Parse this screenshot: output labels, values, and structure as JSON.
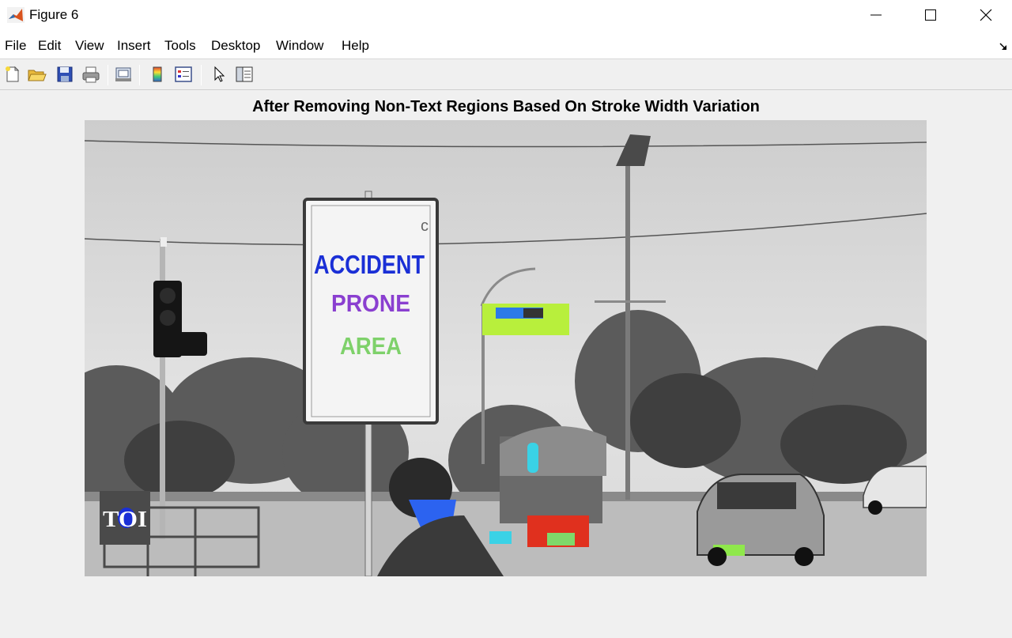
{
  "window": {
    "title": "Figure 6",
    "controls": [
      "minimize",
      "maximize",
      "close"
    ]
  },
  "menu": {
    "items": [
      "File",
      "Edit",
      "View",
      "Insert",
      "Tools",
      "Desktop",
      "Window",
      "Help"
    ]
  },
  "toolbar": {
    "buttons": [
      "new-figure-icon",
      "open-file-icon",
      "save-icon",
      "print-icon",
      "link-plot-icon",
      "insert-colorbar-icon",
      "insert-legend-icon",
      "edit-plot-arrow-icon",
      "property-inspector-icon"
    ]
  },
  "axes": {
    "title": "After Removing Non-Text Regions Based On Stroke Width Variation"
  },
  "image": {
    "sign_text": {
      "line1": "ACCIDENT",
      "line2": "PRONE",
      "line3": "AREA"
    },
    "watermark": "TOI",
    "palette": {
      "blue": "#1a2fd6",
      "red": "#e0301e",
      "cyan": "#3ad2e6",
      "lime": "#b8ef3c",
      "orange": "#f4a23b",
      "green": "#8be05a"
    }
  }
}
